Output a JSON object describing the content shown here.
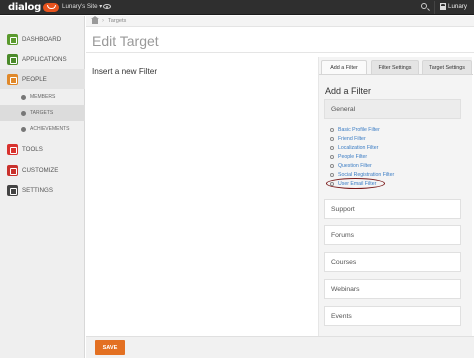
{
  "topbar": {
    "logo_text": "dialog",
    "site_selector": "Lunary's Site ▾",
    "user_name": "Lunary",
    "icons": [
      "eye-icon",
      "search-icon",
      "user-icon"
    ]
  },
  "sidebar": {
    "items": [
      {
        "label": "Dashboard",
        "icon": "dashboard-icon",
        "color": "#5b9a2e"
      },
      {
        "label": "Applications",
        "icon": "applications-icon",
        "color": "#4b8a2a"
      },
      {
        "label": "People",
        "icon": "people-icon",
        "color": "#e0882a"
      },
      {
        "label": "Tools",
        "icon": "tools-icon",
        "color": "#d8322e"
      },
      {
        "label": "Customize",
        "icon": "customize-icon",
        "color": "#c9312c"
      },
      {
        "label": "Settings",
        "icon": "settings-icon",
        "color": "#444444"
      }
    ],
    "subitems": [
      {
        "label": "Members"
      },
      {
        "label": "Targets"
      },
      {
        "label": "Achievements"
      }
    ]
  },
  "breadcrumb": {
    "current": "Targets"
  },
  "page": {
    "title": "Edit Target",
    "insert_label": "Insert a new Filter"
  },
  "panel": {
    "tabs": [
      "Add a Filter",
      "Filter Settings",
      "Target Settings"
    ],
    "active_tab": "Add a Filter",
    "title": "Add a Filter",
    "sections": [
      "General",
      "Support",
      "Forums",
      "Courses",
      "Webinars",
      "Events"
    ],
    "general_filters": [
      "Basic Profile Filter",
      "Friend Filter",
      "Localization Filter",
      "People Filter",
      "Question Filter",
      "Social Registration Filter",
      "User Email Filter"
    ],
    "highlighted_filter": "User Email Filter"
  },
  "footer": {
    "save_label": "SAVE"
  },
  "colors": {
    "accent": "#e37022",
    "link": "#3a7cc4",
    "topbar": "#2f2f2f"
  }
}
